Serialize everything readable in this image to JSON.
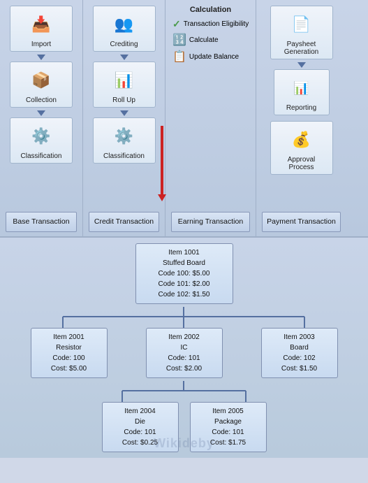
{
  "flow": {
    "col1": {
      "title": null,
      "items": [
        {
          "label": "Import",
          "icon": "📥"
        },
        {
          "label": "Collection",
          "icon": "📦"
        },
        {
          "label": "Classification",
          "icon": "⚙️"
        }
      ],
      "transaction": {
        "line1": "Base Transaction",
        "line2": ""
      }
    },
    "col2": {
      "items": [
        {
          "label": "Crediting",
          "icon": "👥"
        },
        {
          "label": "Roll Up",
          "icon": "📊"
        },
        {
          "label": "Classification",
          "icon": "⚙️"
        }
      ],
      "transaction": {
        "line1": "Credit Transaction",
        "line2": ""
      }
    },
    "col3": {
      "title": "Calculation",
      "items": [
        {
          "label": "Transaction Eligibility",
          "icon": "✓"
        },
        {
          "label": "Calculate",
          "icon": "🔢"
        },
        {
          "label": "Update Balance",
          "icon": "📋"
        }
      ],
      "transaction": {
        "line1": "Earning Transaction",
        "line2": ""
      }
    },
    "col4": {
      "items": [
        {
          "label": "Paysheet Generation",
          "icon": "📄"
        },
        {
          "label": "Reporting",
          "icon": "📊"
        },
        {
          "label": "Approval Process",
          "icon": "💰"
        }
      ],
      "transaction": {
        "line1": "Payment Transaction",
        "line2": ""
      }
    }
  },
  "tree": {
    "root": {
      "line1": "Item 1001",
      "line2": "Stuffed Board",
      "line3": "Code 100: $5.00",
      "line4": "Code 101: $2.00",
      "line5": "Code 102: $1.50"
    },
    "level1": [
      {
        "line1": "Item 2001",
        "line2": "Resistor",
        "line3": "Code: 100",
        "line4": "Cost: $5.00"
      },
      {
        "line1": "Item 2002",
        "line2": "IC",
        "line3": "Code: 101",
        "line4": "Cost: $2.00"
      },
      {
        "line1": "Item 2003",
        "line2": "Board",
        "line3": "Code: 102",
        "line4": "Cost: $1.50"
      }
    ],
    "level2": [
      {
        "line1": "Item 2004",
        "line2": "Die",
        "line3": "Code: 101",
        "line4": "Cost: $0.25"
      },
      {
        "line1": "Item 2005",
        "line2": "Package",
        "line3": "Code: 101",
        "line4": "Cost: $1.75"
      }
    ]
  },
  "watermark": "Wikideby"
}
